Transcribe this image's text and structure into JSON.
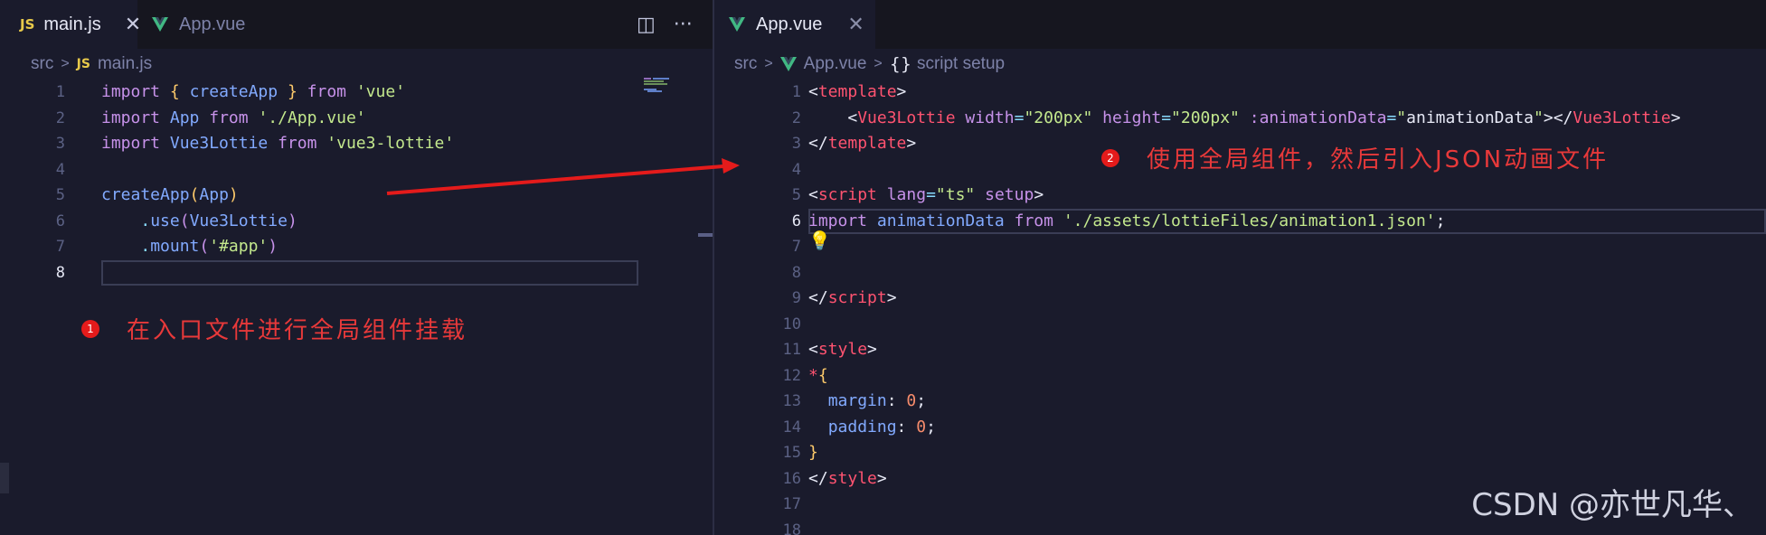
{
  "left": {
    "tabs": [
      {
        "label": "main.js",
        "icon_text": "JS",
        "icon": "js-file-icon",
        "active": true
      },
      {
        "label": "App.vue",
        "icon": "vue-file-icon",
        "active": false
      }
    ],
    "close_glyph": "✕",
    "actions": {
      "split_icon": "split-editor-icon",
      "split_glyph": "◫",
      "more_icon": "more-actions-icon",
      "more_glyph": "···"
    },
    "breadcrumb": {
      "folder": "src",
      "sep": ">",
      "icon_text": "JS",
      "file": "main.js"
    },
    "current_line": "8",
    "lines": [
      {
        "n": "1",
        "tokens": [
          {
            "t": "import",
            "c": "kw"
          },
          {
            "t": " "
          },
          {
            "t": "{",
            "c": "brace"
          },
          {
            "t": " "
          },
          {
            "t": "createApp",
            "c": "fn"
          },
          {
            "t": " "
          },
          {
            "t": "}",
            "c": "brace"
          },
          {
            "t": " "
          },
          {
            "t": "from",
            "c": "kw"
          },
          {
            "t": " "
          },
          {
            "t": "'vue'",
            "c": "str"
          }
        ]
      },
      {
        "n": "2",
        "tokens": [
          {
            "t": "import",
            "c": "kw"
          },
          {
            "t": " "
          },
          {
            "t": "App",
            "c": "fn"
          },
          {
            "t": " "
          },
          {
            "t": "from",
            "c": "kw"
          },
          {
            "t": " "
          },
          {
            "t": "'./App.vue'",
            "c": "str"
          }
        ]
      },
      {
        "n": "3",
        "tokens": [
          {
            "t": "import",
            "c": "kw"
          },
          {
            "t": " "
          },
          {
            "t": "Vue3Lottie",
            "c": "fn"
          },
          {
            "t": " "
          },
          {
            "t": "from",
            "c": "kw"
          },
          {
            "t": " "
          },
          {
            "t": "'vue3-lottie'",
            "c": "str"
          }
        ]
      },
      {
        "n": "4",
        "tokens": []
      },
      {
        "n": "5",
        "tokens": [
          {
            "t": "createApp",
            "c": "fn"
          },
          {
            "t": "(",
            "c": "brace"
          },
          {
            "t": "App",
            "c": "fn"
          },
          {
            "t": ")",
            "c": "brace"
          }
        ]
      },
      {
        "n": "6",
        "tokens": [
          {
            "t": "    "
          },
          {
            "t": ".",
            "c": "punc"
          },
          {
            "t": "use",
            "c": "fn"
          },
          {
            "t": "(",
            "c": "kw"
          },
          {
            "t": "Vue3Lottie",
            "c": "fn"
          },
          {
            "t": ")",
            "c": "kw"
          }
        ]
      },
      {
        "n": "7",
        "tokens": [
          {
            "t": "    "
          },
          {
            "t": ".",
            "c": "punc"
          },
          {
            "t": "mount",
            "c": "fn"
          },
          {
            "t": "(",
            "c": "kw"
          },
          {
            "t": "'#app'",
            "c": "str"
          },
          {
            "t": ")",
            "c": "kw"
          }
        ]
      },
      {
        "n": "8",
        "tokens": []
      }
    ],
    "annotation": {
      "badge": "1",
      "text": "在入口文件进行全局组件挂载"
    }
  },
  "right": {
    "tabs": [
      {
        "label": "App.vue",
        "icon": "vue-file-icon",
        "active": true
      }
    ],
    "close_glyph": "✕",
    "breadcrumb": {
      "folder": "src",
      "sep": ">",
      "file": "App.vue",
      "sep2": ">",
      "braces": "{}",
      "section": "script setup"
    },
    "current_line": "6",
    "lines": [
      {
        "n": "1",
        "tokens": [
          {
            "t": "<",
            "c": "tagb"
          },
          {
            "t": "template",
            "c": "tag"
          },
          {
            "t": ">",
            "c": "tagb"
          }
        ]
      },
      {
        "n": "2",
        "tokens": [
          {
            "t": "    "
          },
          {
            "t": "<",
            "c": "tagb"
          },
          {
            "t": "Vue3Lottie",
            "c": "tag"
          },
          {
            "t": " "
          },
          {
            "t": "width",
            "c": "attr"
          },
          {
            "t": "=",
            "c": "punc"
          },
          {
            "t": "\"200px\"",
            "c": "str"
          },
          {
            "t": " "
          },
          {
            "t": "height",
            "c": "attr"
          },
          {
            "t": "=",
            "c": "punc"
          },
          {
            "t": "\"200px\"",
            "c": "str"
          },
          {
            "t": " "
          },
          {
            "t": ":animationData",
            "c": "attr"
          },
          {
            "t": "=",
            "c": "punc"
          },
          {
            "t": "\"",
            "c": "str"
          },
          {
            "t": "animationData",
            "c": "plain"
          },
          {
            "t": "\"",
            "c": "str"
          },
          {
            "t": "></",
            "c": "tagb"
          },
          {
            "t": "Vue3Lottie",
            "c": "tag"
          },
          {
            "t": ">",
            "c": "tagb"
          }
        ]
      },
      {
        "n": "3",
        "tokens": [
          {
            "t": "</",
            "c": "tagb"
          },
          {
            "t": "template",
            "c": "tag"
          },
          {
            "t": ">",
            "c": "tagb"
          }
        ]
      },
      {
        "n": "4",
        "tokens": []
      },
      {
        "n": "5",
        "tokens": [
          {
            "t": "<",
            "c": "tagb"
          },
          {
            "t": "script",
            "c": "tag"
          },
          {
            "t": " "
          },
          {
            "t": "lang",
            "c": "attr"
          },
          {
            "t": "=",
            "c": "punc"
          },
          {
            "t": "\"ts\"",
            "c": "str"
          },
          {
            "t": " "
          },
          {
            "t": "setup",
            "c": "attr"
          },
          {
            "t": ">",
            "c": "tagb"
          }
        ]
      },
      {
        "n": "6",
        "tokens": [
          {
            "t": "import",
            "c": "kw"
          },
          {
            "t": " "
          },
          {
            "t": "animationData",
            "c": "fn"
          },
          {
            "t": " "
          },
          {
            "t": "from",
            "c": "kw"
          },
          {
            "t": " "
          },
          {
            "t": "'./assets/lottieFiles/animation1.json'",
            "c": "str"
          },
          {
            "t": ";",
            "c": "plain"
          }
        ]
      },
      {
        "n": "7",
        "tokens": []
      },
      {
        "n": "8",
        "tokens": []
      },
      {
        "n": "9",
        "tokens": [
          {
            "t": "</",
            "c": "tagb"
          },
          {
            "t": "script",
            "c": "tag"
          },
          {
            "t": ">",
            "c": "tagb"
          }
        ]
      },
      {
        "n": "10",
        "tokens": []
      },
      {
        "n": "11",
        "tokens": [
          {
            "t": "<",
            "c": "tagb"
          },
          {
            "t": "style",
            "c": "tag"
          },
          {
            "t": ">",
            "c": "tagb"
          }
        ]
      },
      {
        "n": "12",
        "tokens": [
          {
            "t": "*",
            "c": "tag"
          },
          {
            "t": "{",
            "c": "brace"
          }
        ]
      },
      {
        "n": "13",
        "tokens": [
          {
            "t": "  "
          },
          {
            "t": "margin",
            "c": "prop"
          },
          {
            "t": ": ",
            "c": "plain"
          },
          {
            "t": "0",
            "c": "num"
          },
          {
            "t": ";",
            "c": "plain"
          }
        ]
      },
      {
        "n": "14",
        "tokens": [
          {
            "t": "  "
          },
          {
            "t": "padding",
            "c": "prop"
          },
          {
            "t": ": ",
            "c": "plain"
          },
          {
            "t": "0",
            "c": "num"
          },
          {
            "t": ";",
            "c": "plain"
          }
        ]
      },
      {
        "n": "15",
        "tokens": [
          {
            "t": "}",
            "c": "brace"
          }
        ]
      },
      {
        "n": "16",
        "tokens": [
          {
            "t": "</",
            "c": "tagb"
          },
          {
            "t": "style",
            "c": "tag"
          },
          {
            "t": ">",
            "c": "tagb"
          }
        ]
      },
      {
        "n": "17",
        "tokens": []
      },
      {
        "n": "18",
        "tokens": []
      }
    ],
    "annotation": {
      "badge": "2",
      "text": "使用全局组件，然后引入JSON动画文件"
    }
  },
  "lightbulb_icon": "lightbulb-icon",
  "lightbulb_glyph": "💡",
  "watermark": "CSDN @亦世凡华、",
  "colors": {
    "annotation": "#e8393a",
    "badge": "#e41b1b",
    "arrow": "#e41b1b",
    "background": "#1a1b2c",
    "tabbar": "#16161f"
  }
}
